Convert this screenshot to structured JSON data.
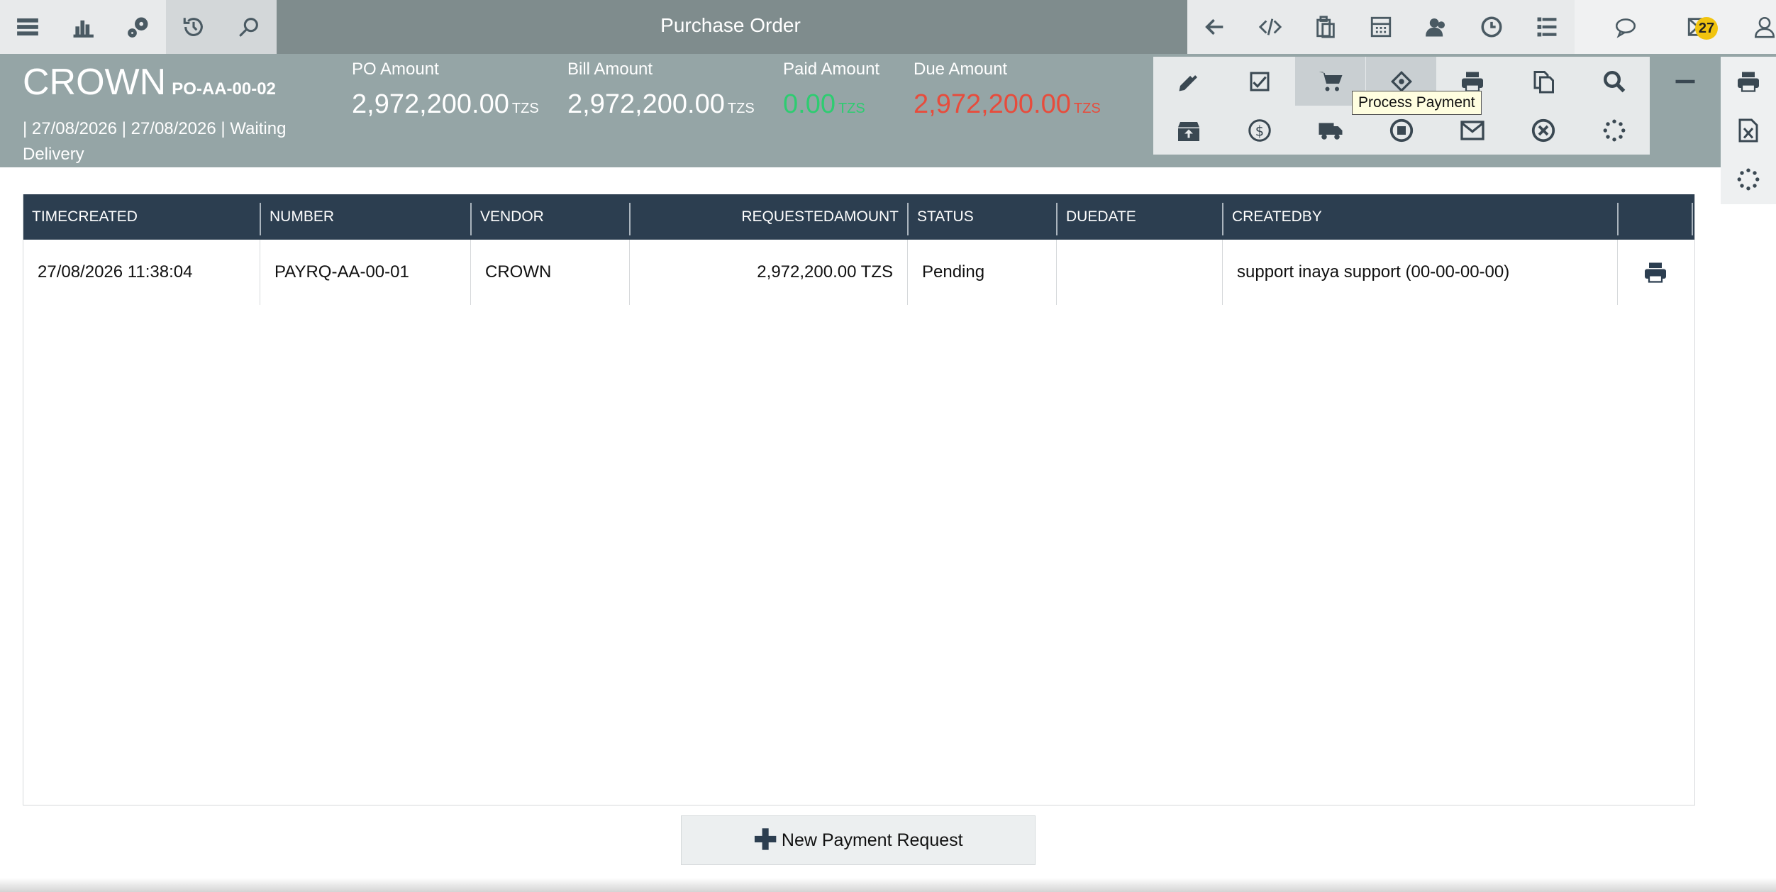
{
  "window": {
    "title": "Purchase Order"
  },
  "topbar": {
    "left_icons": [
      "menu-icon",
      "chart-icon",
      "gears-icon",
      "history-icon",
      "search-icon"
    ],
    "right_icons": [
      "back-arrow-icon",
      "code-icon",
      "clipboard-icon",
      "calculator-icon",
      "users-icon",
      "clock-icon",
      "list-icon"
    ],
    "far_icons": [
      "chat-icon",
      "mail-icon",
      "user-icon"
    ],
    "notification_count": "27"
  },
  "header": {
    "vendor": "CROWN",
    "po_number": "PO-AA-00-02",
    "meta": "| 27/08/2026 | 27/08/2026 | Waiting Delivery",
    "amounts": [
      {
        "label": "PO Amount",
        "value": "2,972,200.00",
        "currency": "TZS",
        "color": "#ffffff"
      },
      {
        "label": "Bill Amount",
        "value": "2,972,200.00",
        "currency": "TZS",
        "color": "#ffffff"
      },
      {
        "label": "Paid Amount",
        "value": "0.00",
        "currency": "TZS",
        "color": "#2ecc71"
      },
      {
        "label": "Due Amount",
        "value": "2,972,200.00",
        "currency": "TZS",
        "color": "#e74c3c"
      }
    ]
  },
  "actions": {
    "row1": [
      "edit-icon",
      "approve-icon",
      "cart-icon",
      "process-payment-icon",
      "print-icon",
      "copy-icon",
      "search-icon",
      "minus-icon"
    ],
    "row2": [
      "archive-icon",
      "dollar-icon",
      "truck-icon",
      "stop-icon",
      "email-icon",
      "cancel-icon",
      "spinner-icon"
    ],
    "tooltip": "Process Payment",
    "side": [
      "print-icon",
      "excel-icon",
      "spinner-icon"
    ]
  },
  "table": {
    "columns": [
      "TIMECREATED",
      "NUMBER",
      "VENDOR",
      "REQUESTEDAMOUNT",
      "STATUS",
      "DUEDATE",
      "CREATEDBY",
      ""
    ],
    "rows": [
      {
        "timecreated": "27/08/2026 11:38:04",
        "number": "PAYRQ-AA-00-01",
        "vendor": "CROWN",
        "requestedamount": "2,972,200.00 TZS",
        "status": "Pending",
        "duedate": "",
        "createdby": "support inaya support (00-00-00-00)"
      }
    ]
  },
  "new_button": {
    "label": "New Payment Request"
  }
}
